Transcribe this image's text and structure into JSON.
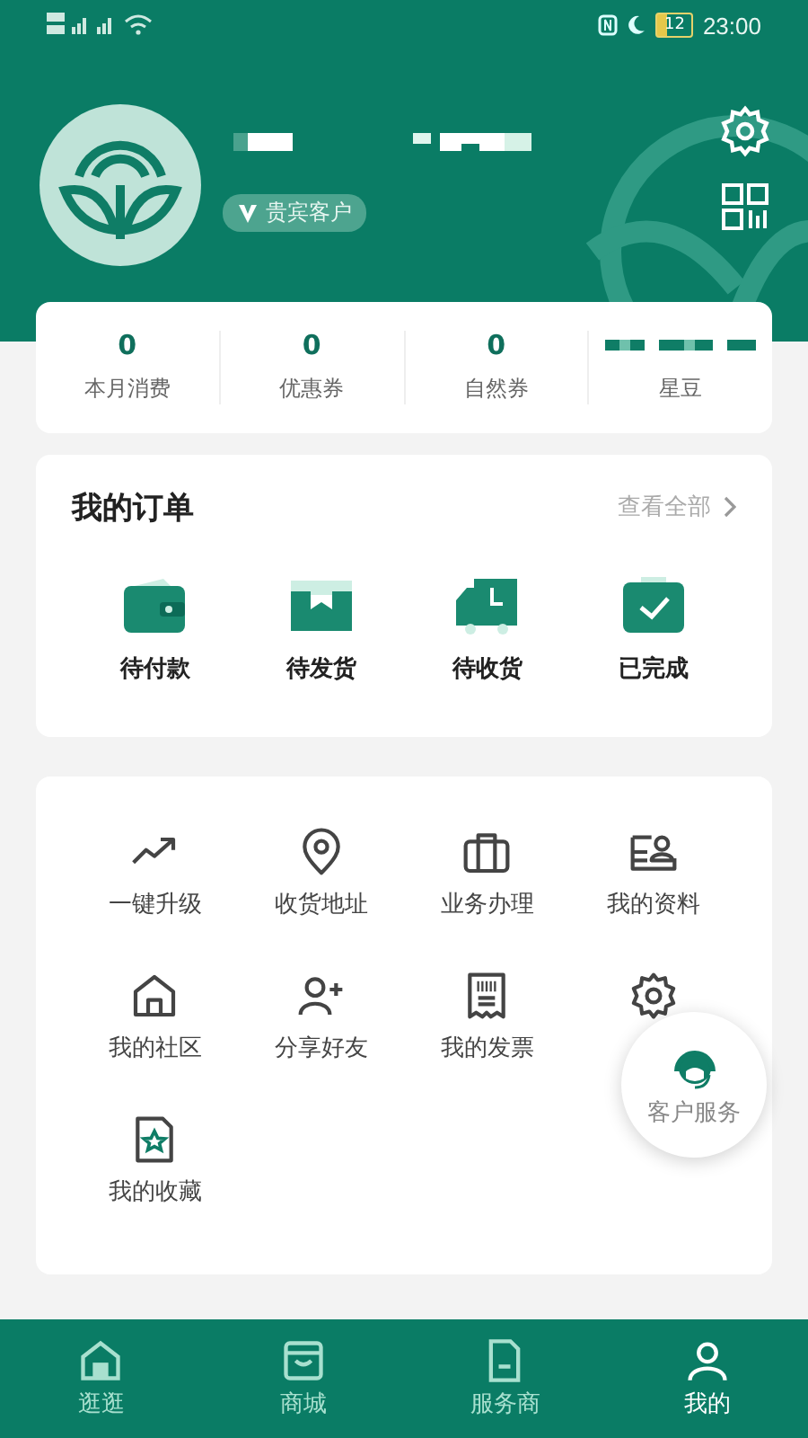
{
  "status_bar": {
    "battery": "12",
    "time": "23:00"
  },
  "profile": {
    "badge": "贵宾客户"
  },
  "stats": [
    {
      "value": "0",
      "label": "本月消费",
      "redacted": false
    },
    {
      "value": "0",
      "label": "优惠券",
      "redacted": false
    },
    {
      "value": "0",
      "label": "自然券",
      "redacted": false
    },
    {
      "label": "星豆",
      "redacted": true
    }
  ],
  "orders": {
    "title": "我的订单",
    "view_all": "查看全部",
    "items": [
      {
        "kind": "wallet",
        "label": "待付款"
      },
      {
        "kind": "box",
        "label": "待发货"
      },
      {
        "kind": "truck",
        "label": "待收货"
      },
      {
        "kind": "done",
        "label": "已完成"
      }
    ]
  },
  "services": [
    {
      "kind": "trend",
      "label": "一键升级"
    },
    {
      "kind": "pin",
      "label": "收货地址"
    },
    {
      "kind": "case",
      "label": "业务办理"
    },
    {
      "kind": "profile",
      "label": "我的资料"
    },
    {
      "kind": "home",
      "label": "我的社区"
    },
    {
      "kind": "adduser",
      "label": "分享好友"
    },
    {
      "kind": "invoice",
      "label": "我的发票"
    },
    {
      "kind": "gear"
    },
    {
      "kind": "fav",
      "label": "我的收藏"
    }
  ],
  "float_button": {
    "label": "客户服务"
  },
  "tabs": [
    {
      "kind": "home",
      "label": "逛逛",
      "selected": false
    },
    {
      "kind": "bag",
      "label": "商城",
      "selected": false
    },
    {
      "kind": "doc",
      "label": "服务商",
      "selected": false
    },
    {
      "kind": "user",
      "label": "我的",
      "selected": true
    }
  ]
}
